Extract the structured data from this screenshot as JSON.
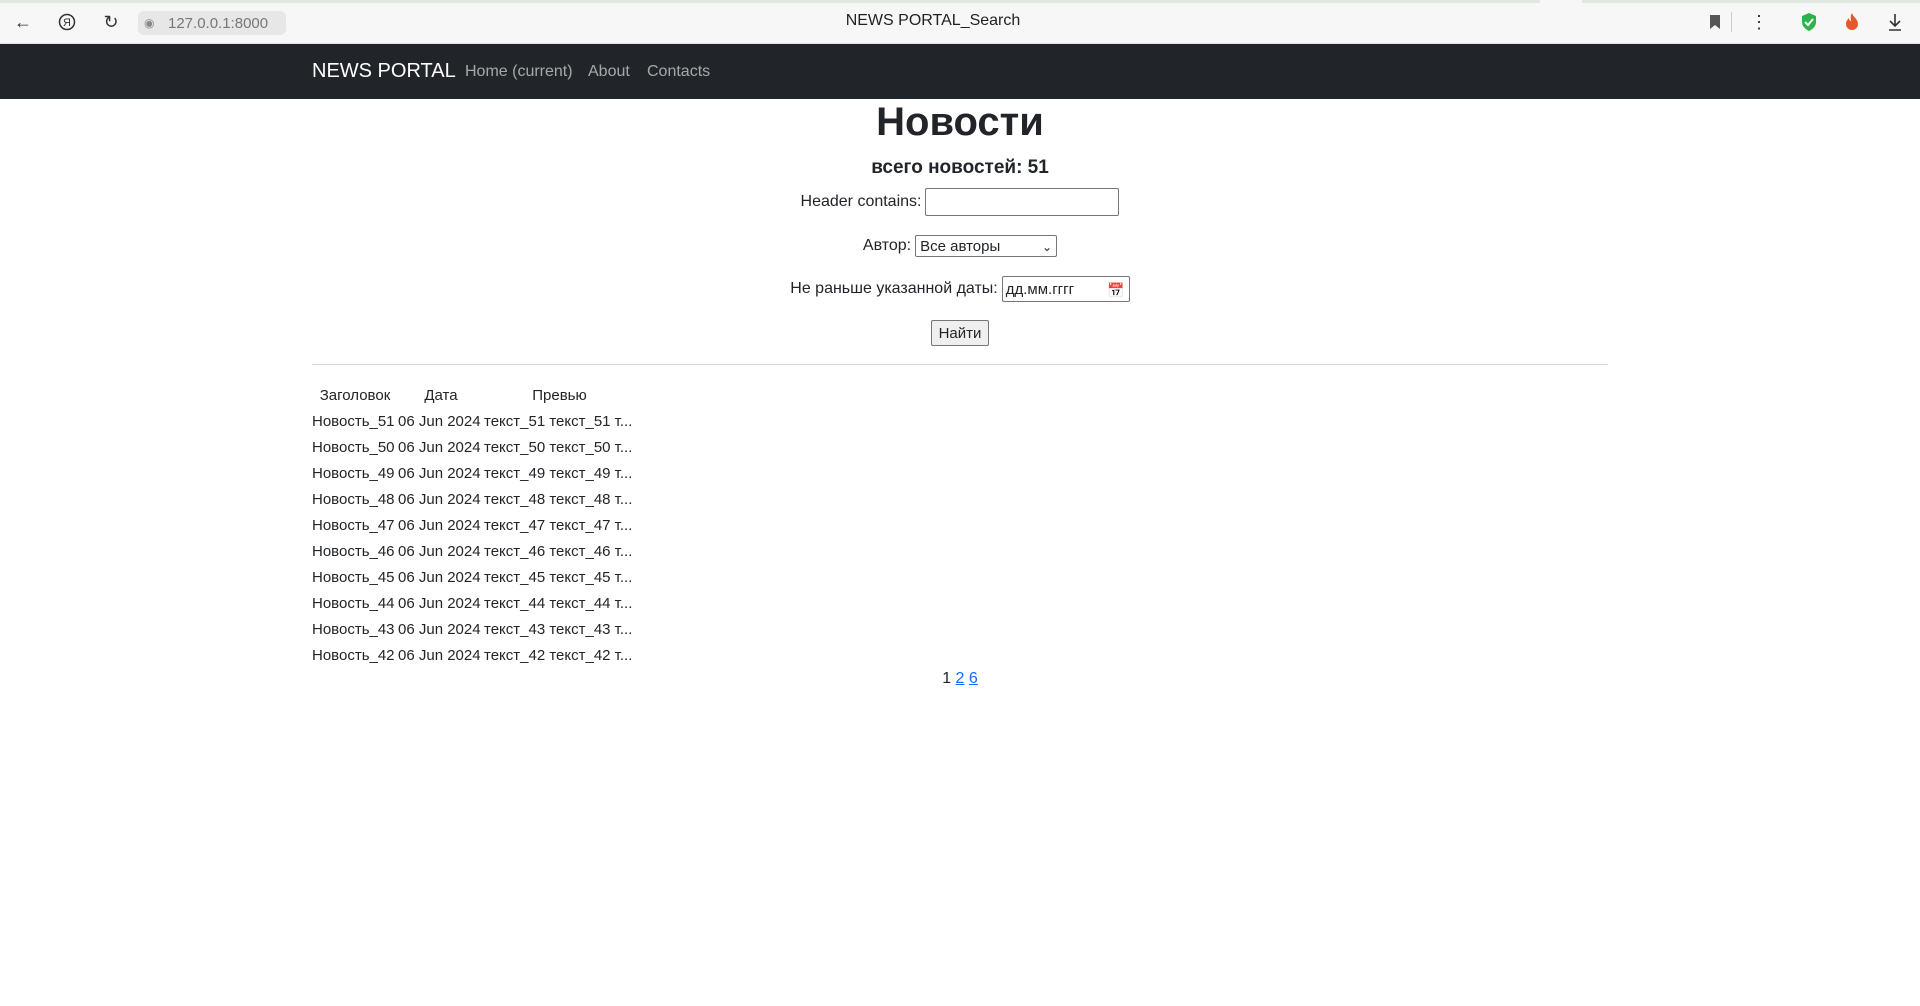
{
  "browser": {
    "url": "127.0.0.1:8000",
    "tab_title": "NEWS PORTAL_Search"
  },
  "navbar": {
    "brand": "NEWS PORTAL",
    "links": [
      "Home (current)",
      "About",
      "Contacts"
    ]
  },
  "main": {
    "title": "Новости",
    "total_label": "всего новостей: 51"
  },
  "filters": {
    "header_label": "Header contains:",
    "header_value": "",
    "author_label": "Автор:",
    "author_selected": "Все авторы",
    "date_label": "Не раньше указанной даты:",
    "date_placeholder": "дд.мм.гггг",
    "submit_label": "Найти"
  },
  "table": {
    "columns": [
      "Заголовок",
      "Дата",
      "Превью"
    ],
    "rows": [
      [
        "Новость_51",
        "06 Jun 2024",
        "текст_51 текст_51 т..."
      ],
      [
        "Новость_50",
        "06 Jun 2024",
        "текст_50 текст_50 т..."
      ],
      [
        "Новость_49",
        "06 Jun 2024",
        "текст_49 текст_49 т..."
      ],
      [
        "Новость_48",
        "06 Jun 2024",
        "текст_48 текст_48 т..."
      ],
      [
        "Новость_47",
        "06 Jun 2024",
        "текст_47 текст_47 т..."
      ],
      [
        "Новость_46",
        "06 Jun 2024",
        "текст_46 текст_46 т..."
      ],
      [
        "Новость_45",
        "06 Jun 2024",
        "текст_45 текст_45 т..."
      ],
      [
        "Новость_44",
        "06 Jun 2024",
        "текст_44 текст_44 т..."
      ],
      [
        "Новость_43",
        "06 Jun 2024",
        "текст_43 текст_43 т..."
      ],
      [
        "Новость_42",
        "06 Jun 2024",
        "текст_42 текст_42 т..."
      ]
    ]
  },
  "pagination": {
    "current": "1",
    "links": [
      "2",
      "6"
    ]
  },
  "colors": {
    "navbar_bg": "#212529",
    "link": "#0d6efd",
    "shield": "#2fb24c",
    "fire": "#e8572c"
  }
}
